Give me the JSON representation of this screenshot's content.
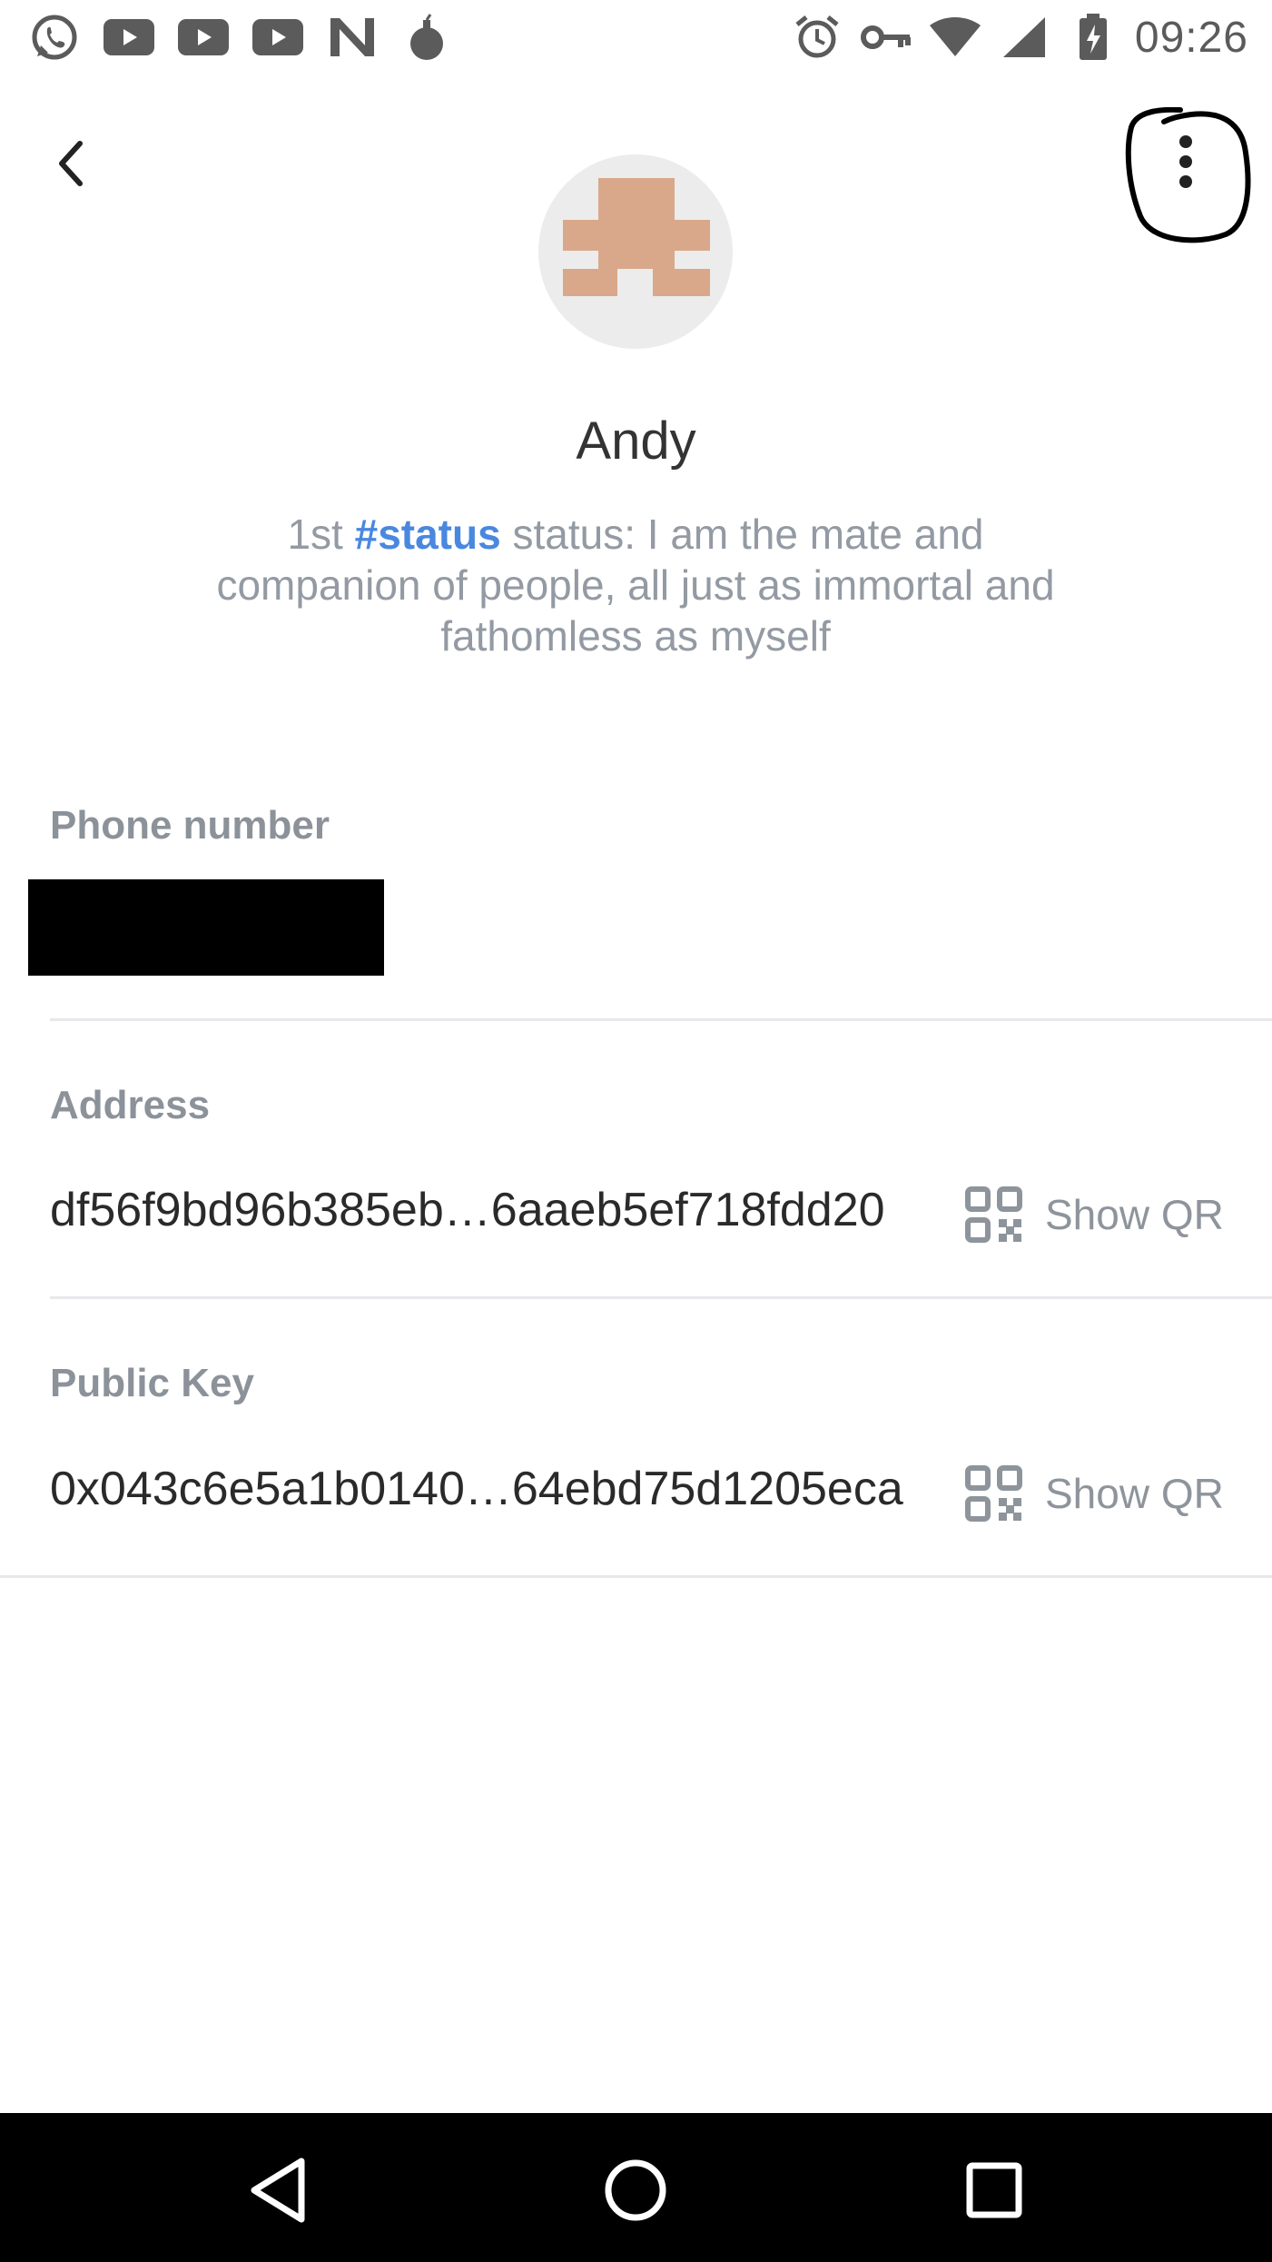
{
  "status_bar": {
    "time": "09:26",
    "left_icons": [
      "whatsapp-icon",
      "youtube-icon",
      "youtube-icon",
      "youtube-icon",
      "n-icon",
      "bomb-icon"
    ],
    "right_icons": [
      "alarm-icon",
      "key-icon",
      "wifi-icon",
      "signal-icon",
      "battery-charging-icon"
    ]
  },
  "header": {
    "back_icon": "chevron-left-icon",
    "menu_icon": "more-vertical-icon"
  },
  "profile": {
    "name": "Andy",
    "status_prefix": "1st ",
    "status_tag": "#status",
    "status_rest": " status: I am the mate and companion of people, all just as immortal and fathomless as myself"
  },
  "fields": {
    "phone": {
      "label": "Phone number"
    },
    "address": {
      "label": "Address",
      "value": "df56f9bd96b385eb…6aaeb5ef718fdd20",
      "qr_label": "Show QR"
    },
    "public_key": {
      "label": "Public Key",
      "value": "0x043c6e5a1b0140…64ebd75d1205eca",
      "qr_label": "Show QR"
    }
  },
  "colors": {
    "accent": "#4a88e0",
    "label": "#8c9299",
    "avatar_block": "#d9a88a"
  }
}
